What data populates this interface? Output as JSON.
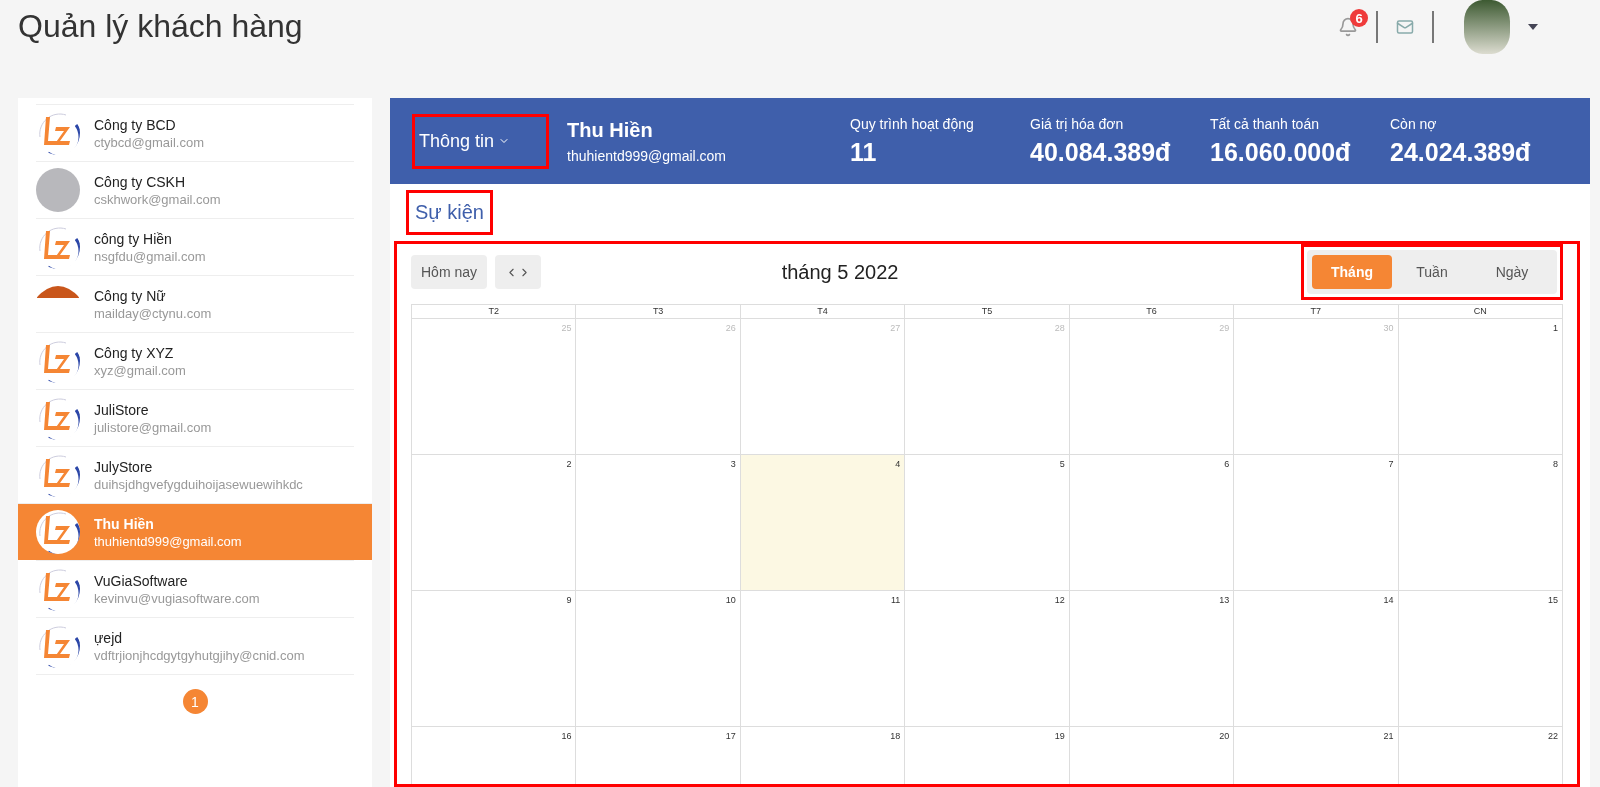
{
  "page_title": "Quản lý khách hàng",
  "topbar": {
    "notification_count": "6"
  },
  "customers": [
    {
      "name": "Công ty BCD",
      "email": "ctybcd@gmail.com",
      "kind": "logo",
      "selected": false
    },
    {
      "name": "Công ty CSKH",
      "email": "cskhwork@gmail.com",
      "kind": "photo",
      "selected": false
    },
    {
      "name": "công ty Hiền",
      "email": "nsgfdu@gmail.com",
      "kind": "logo",
      "selected": false
    },
    {
      "name": "Công ty Nữ",
      "email": "mailday@ctynu.com",
      "kind": "partial",
      "selected": false
    },
    {
      "name": "Công ty XYZ",
      "email": "xyz@gmail.com",
      "kind": "logo",
      "selected": false
    },
    {
      "name": "JuliStore",
      "email": "julistore@gmail.com",
      "kind": "logo",
      "selected": false
    },
    {
      "name": "JulyStore",
      "email": "duihsjdhgvefygduihoijasewuewihkdc",
      "kind": "logo",
      "selected": false
    },
    {
      "name": "Thu Hiền",
      "email": "thuhientd999@gmail.com",
      "kind": "logo",
      "selected": true
    },
    {
      "name": "VuGiaSoftware",
      "email": "kevinvu@vugiasoftware.com",
      "kind": "logo",
      "selected": false
    },
    {
      "name": "ựejd",
      "email": "vdftrjionjhcdgytgyhutgjihy@cnid.com",
      "kind": "logo",
      "selected": false
    }
  ],
  "pagination": [
    {
      "label": "1",
      "selected": true
    }
  ],
  "profile": {
    "menu_label": "Thông tin",
    "menu_highlighted": true,
    "name": "Thu Hiền",
    "email": "thuhientd999@gmail.com"
  },
  "stats": [
    {
      "label": "Quy trình hoạt động",
      "value": "11"
    },
    {
      "label": "Giá trị hóa đơn",
      "value": "40.084.389đ"
    },
    {
      "label": "Tất cả thanh toán",
      "value": "16.060.000đ"
    },
    {
      "label": "Còn nợ",
      "value": "24.024.389đ"
    }
  ],
  "events": {
    "title": "Sự kiện",
    "title_highlighted": true,
    "calendar_highlighted": true,
    "today_button": "Hôm nay",
    "month_title": "tháng 5 2022",
    "views_highlighted": true,
    "views": [
      {
        "label": "Tháng",
        "selected": true
      },
      {
        "label": "Tuần",
        "selected": false
      },
      {
        "label": "Ngày",
        "selected": false
      }
    ],
    "weekdays": [
      "T2",
      "T3",
      "T4",
      "T5",
      "T6",
      "T7",
      "CN"
    ],
    "weeks": [
      [
        {
          "day": "25",
          "other_month": true,
          "today": false
        },
        {
          "day": "26",
          "other_month": true,
          "today": false
        },
        {
          "day": "27",
          "other_month": true,
          "today": false
        },
        {
          "day": "28",
          "other_month": true,
          "today": false
        },
        {
          "day": "29",
          "other_month": true,
          "today": false
        },
        {
          "day": "30",
          "other_month": true,
          "today": false
        },
        {
          "day": "1",
          "other_month": false,
          "today": false
        }
      ],
      [
        {
          "day": "2",
          "other_month": false,
          "today": false
        },
        {
          "day": "3",
          "other_month": false,
          "today": false
        },
        {
          "day": "4",
          "other_month": false,
          "today": true
        },
        {
          "day": "5",
          "other_month": false,
          "today": false
        },
        {
          "day": "6",
          "other_month": false,
          "today": false
        },
        {
          "day": "7",
          "other_month": false,
          "today": false
        },
        {
          "day": "8",
          "other_month": false,
          "today": false
        }
      ],
      [
        {
          "day": "9",
          "other_month": false,
          "today": false
        },
        {
          "day": "10",
          "other_month": false,
          "today": false
        },
        {
          "day": "11",
          "other_month": false,
          "today": false
        },
        {
          "day": "12",
          "other_month": false,
          "today": false
        },
        {
          "day": "13",
          "other_month": false,
          "today": false
        },
        {
          "day": "14",
          "other_month": false,
          "today": false
        },
        {
          "day": "15",
          "other_month": false,
          "today": false
        }
      ],
      [
        {
          "day": "16",
          "other_month": false,
          "today": false
        },
        {
          "day": "17",
          "other_month": false,
          "today": false
        },
        {
          "day": "18",
          "other_month": false,
          "today": false
        },
        {
          "day": "19",
          "other_month": false,
          "today": false
        },
        {
          "day": "20",
          "other_month": false,
          "today": false
        },
        {
          "day": "21",
          "other_month": false,
          "today": false
        },
        {
          "day": "22",
          "other_month": false,
          "today": false
        }
      ]
    ]
  }
}
